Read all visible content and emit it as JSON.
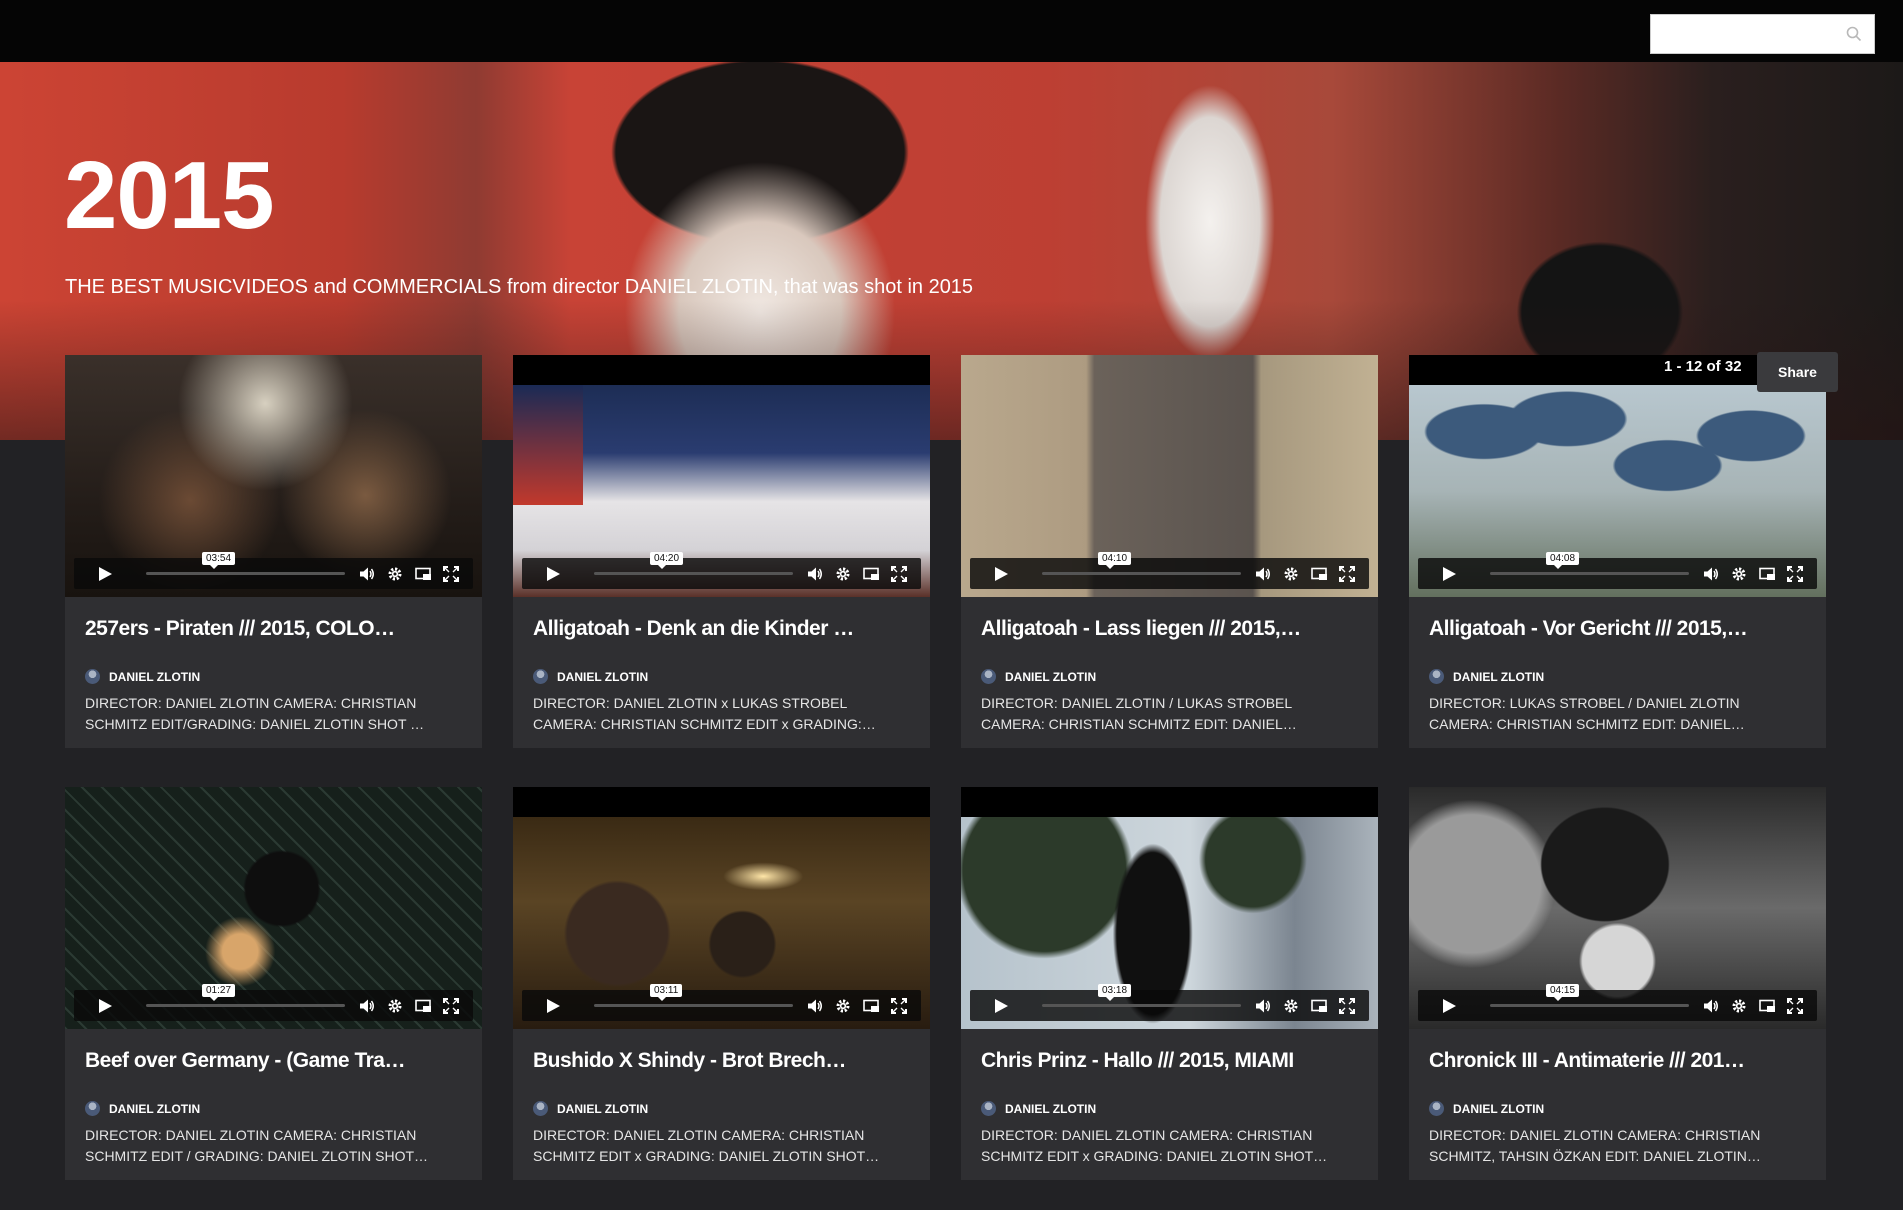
{
  "search": {
    "placeholder": ""
  },
  "hero": {
    "title": "2015",
    "description": "THE BEST MUSICVIDEOS and COMMERCIALS from director DANIEL ZLOTIN, that was shot in 2015",
    "count": "1 - 12 of 32",
    "share_label": "Share"
  },
  "videos": [
    {
      "title": "257ers - Piraten /// 2015, COLO…",
      "duration": "03:54",
      "author": "DANIEL ZLOTIN",
      "description": "DIRECTOR: DANIEL ZLOTIN CAMERA: CHRISTIAN SCHMITZ EDIT/GRADING: DANIEL ZLOTIN SHOT …"
    },
    {
      "title": "Alligatoah - Denk an die Kinder …",
      "duration": "04:20",
      "author": "DANIEL ZLOTIN",
      "description": "DIRECTOR: DANIEL ZLOTIN x LUKAS STROBEL CAMERA: CHRISTIAN SCHMITZ EDIT x GRADING:…"
    },
    {
      "title": "Alligatoah - Lass liegen /// 2015,…",
      "duration": "04:10",
      "author": "DANIEL ZLOTIN",
      "description": "DIRECTOR: DANIEL ZLOTIN / LUKAS STROBEL CAMERA: CHRISTIAN SCHMITZ EDIT: DANIEL…"
    },
    {
      "title": "Alligatoah - Vor Gericht /// 2015,…",
      "duration": "04:08",
      "author": "DANIEL ZLOTIN",
      "description": "DIRECTOR: LUKAS STROBEL / DANIEL ZLOTIN CAMERA: CHRISTIAN SCHMITZ EDIT: DANIEL…"
    },
    {
      "title": "Beef over Germany - (Game Tra…",
      "duration": "01:27",
      "author": "DANIEL ZLOTIN",
      "description": "DIRECTOR: DANIEL ZLOTIN CAMERA: CHRISTIAN SCHMITZ EDIT / GRADING: DANIEL ZLOTIN SHOT…"
    },
    {
      "title": "Bushido X Shindy - Brot Brech…",
      "duration": "03:11",
      "author": "DANIEL ZLOTIN",
      "description": "DIRECTOR: DANIEL ZLOTIN CAMERA: CHRISTIAN SCHMITZ EDIT x GRADING: DANIEL ZLOTIN SHOT…"
    },
    {
      "title": "Chris Prinz - Hallo /// 2015, MIAMI",
      "duration": "03:18",
      "author": "DANIEL ZLOTIN",
      "description": "DIRECTOR: DANIEL ZLOTIN CAMERA: CHRISTIAN SCHMITZ EDIT x GRADING: DANIEL ZLOTIN SHOT…"
    },
    {
      "title": "Chronick III - Antimaterie /// 201…",
      "duration": "04:15",
      "author": "DANIEL ZLOTIN",
      "description": "DIRECTOR: DANIEL ZLOTIN CAMERA: CHRISTIAN SCHMITZ, TAHSIN ÖZKAN EDIT: DANIEL ZLOTIN…"
    }
  ],
  "colors": {
    "topbar": "#050505",
    "page_bg": "#222225",
    "card_bg": "#2f2f32",
    "share_bg": "#3a3a3d"
  },
  "icons": [
    "search-icon",
    "play-icon",
    "volume-icon",
    "gear-icon",
    "pip-icon",
    "fullscreen-icon",
    "avatar"
  ]
}
